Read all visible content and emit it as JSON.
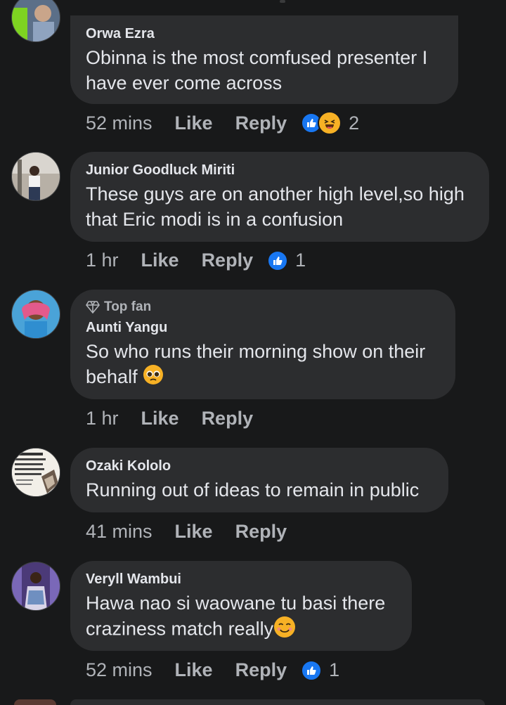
{
  "comments": [
    {
      "name": "Orwa Ezra",
      "text": "Obinna is the most comfused presenter I have ever come across",
      "time": "52 mins",
      "like_label": "Like",
      "reply_label": "Reply",
      "reaction_count": "2",
      "reactions": [
        "like",
        "haha"
      ]
    },
    {
      "name": "Junior Goodluck Miriti",
      "text": "These guys are on another high level,so high that Eric modi is in a confusion",
      "time": "1 hr",
      "like_label": "Like",
      "reply_label": "Reply",
      "reaction_count": "1",
      "reactions": [
        "like"
      ]
    },
    {
      "badge": "Top fan",
      "name": "Aunti Yangu",
      "text": "So who runs their morning show on their behalf",
      "emoji": "pleading-face",
      "time": "1 hr",
      "like_label": "Like",
      "reply_label": "Reply"
    },
    {
      "name": "Ozaki Kololo",
      "text": "Running out of ideas to remain in public",
      "time": "41 mins",
      "like_label": "Like",
      "reply_label": "Reply",
      "avatar_text": "Africa will be regrouping ot again and the ths whose future eing stolen will be celebrating it..."
    },
    {
      "name": "Veryll Wambui",
      "text": "Hawa nao si waowane tu basi there craziness match really",
      "emoji": "smiling-face",
      "time": "52 mins",
      "like_label": "Like",
      "reply_label": "Reply",
      "reaction_count": "1",
      "reactions": [
        "like"
      ]
    }
  ],
  "colors": {
    "background": "#18191a",
    "bubble": "#2c2d2f",
    "text_primary": "#e4e6eb",
    "text_secondary": "#b0b3b8",
    "like_blue": "#1877f2",
    "haha_yellow": "#f7b125"
  }
}
